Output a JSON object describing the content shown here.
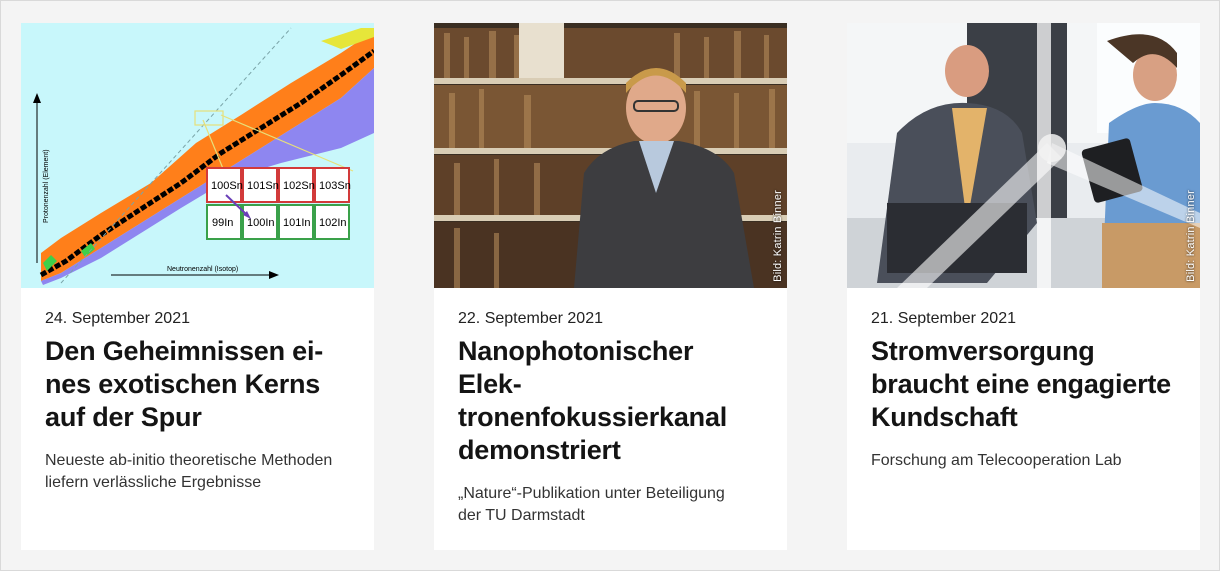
{
  "cards": [
    {
      "date": "24. September 2021",
      "title_lines": [
        "Den Geheimnissen ei-",
        "nes exotischen Kerns",
        "auf der Spur"
      ],
      "teaser_lines": [
        "Neueste ab-initio theoretische Methoden",
        "liefern verlässliche Ergebnisse"
      ],
      "image": {
        "description_icon": "nuclide-chart-image",
        "axis_y": "Protonenzahl (Element)",
        "axis_x": "Neutronenzahl (Isotop)",
        "top_row": [
          "100Sn",
          "101Sn",
          "102Sn",
          "103Sn"
        ],
        "bottom_row": [
          "99In",
          "100In",
          "101In",
          "102In"
        ]
      }
    },
    {
      "date": "22. September 2021",
      "title_lines": [
        "Nanophotonischer Elek-",
        "tronenfokussierkanal",
        "demonstriert"
      ],
      "teaser_lines": [
        "„Nature“-Publikation unter Beteiligung",
        "der TU Darmstadt"
      ],
      "image": {
        "credit": "Bild: Katrin Binner"
      }
    },
    {
      "date": "21. September 2021",
      "title_lines": [
        "Stromversorgung",
        "braucht eine engagierte",
        "Kundschaft"
      ],
      "teaser_lines": [
        "Forschung am Telecooperation Lab"
      ],
      "image": {
        "credit": "Bild: Katrin Binner"
      }
    }
  ],
  "colors": {
    "card_bg": "#ffffff",
    "page_bg": "#f4f4f4",
    "chart_bg": "#c8f7fb",
    "chart_orange": "#ff7f1a",
    "chart_purple": "#8e86f0"
  }
}
